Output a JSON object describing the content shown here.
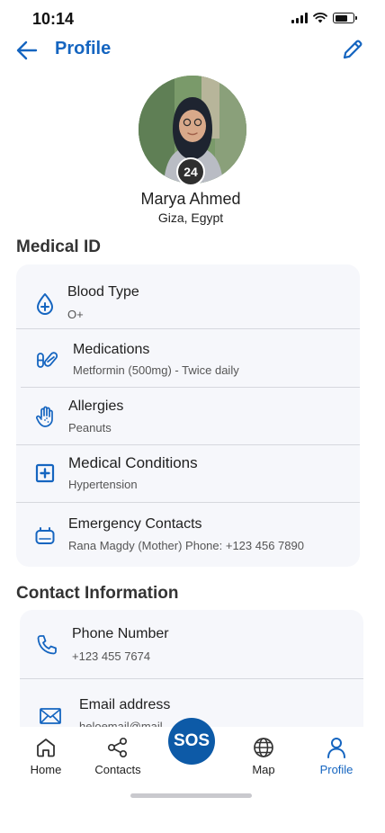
{
  "status_bar": {
    "time": "10:14",
    "battery_level": 0.7
  },
  "header": {
    "title": "Profile",
    "back_icon": "arrow-left-icon",
    "edit_icon": "pencil-icon"
  },
  "profile": {
    "age_badge": "24",
    "name": "Marya Ahmed",
    "location": "Giza, Egypt"
  },
  "medical_id": {
    "title": "Medical ID",
    "items": [
      {
        "label": "Blood Type",
        "value": "O+",
        "icon": "blood-drop-icon"
      },
      {
        "label": "Medications",
        "value": "Metformin (500mg) - Twice daily",
        "icon": "pill-icon"
      },
      {
        "label": "Allergies",
        "value": "Peanuts",
        "icon": "hand-icon"
      },
      {
        "label": "Medical Conditions",
        "value": "Hypertension",
        "icon": "medical-cross-icon"
      },
      {
        "label": "Emergency Contacts",
        "value": "Rana Magdy (Mother) Phone: +123 456 7890",
        "icon": "contact-icon"
      }
    ]
  },
  "contact_info": {
    "title": "Contact Information",
    "items": [
      {
        "label": "Phone Number",
        "value": "+123 455 7674",
        "icon": "phone-icon"
      },
      {
        "label": "Email address",
        "value": "heloemail@mail",
        "icon": "mail-icon"
      }
    ]
  },
  "nav": {
    "items": [
      {
        "label": "Home",
        "icon": "home-icon"
      },
      {
        "label": "Contacts",
        "icon": "share-icon"
      },
      {
        "label": "Map",
        "icon": "globe-icon"
      },
      {
        "label": "Profile",
        "icon": "user-icon",
        "active": true
      }
    ],
    "sos_label": "SOS"
  },
  "colors": {
    "accent": "#1565c0",
    "sos": "#0d5aa7",
    "card_bg": "#f6f7fb"
  }
}
